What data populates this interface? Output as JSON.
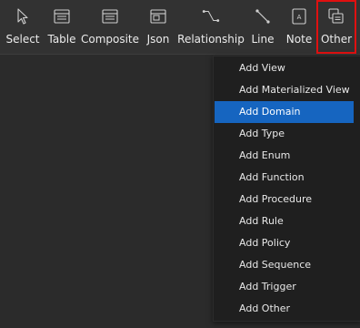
{
  "toolbar": {
    "tools": [
      {
        "label": "Select",
        "icon": "cursor-icon"
      },
      {
        "label": "Table",
        "icon": "table-icon"
      },
      {
        "label": "Composite",
        "icon": "composite-icon"
      },
      {
        "label": "Json",
        "icon": "json-icon"
      },
      {
        "label": "Relationship",
        "icon": "relationship-icon"
      },
      {
        "label": "Line",
        "icon": "line-icon"
      },
      {
        "label": "Note",
        "icon": "note-icon"
      },
      {
        "label": "Other",
        "icon": "other-icon"
      }
    ],
    "note_glyph": "A",
    "active_tool": "Other",
    "active_outline_color": "#e01010"
  },
  "menu": {
    "items": [
      "Add View",
      "Add Materialized View",
      "Add Domain",
      "Add Type",
      "Add Enum",
      "Add Function",
      "Add Procedure",
      "Add Rule",
      "Add Policy",
      "Add Sequence",
      "Add Trigger",
      "Add Other"
    ],
    "highlighted_item": "Add Domain",
    "highlight_color": "#1665c0"
  }
}
